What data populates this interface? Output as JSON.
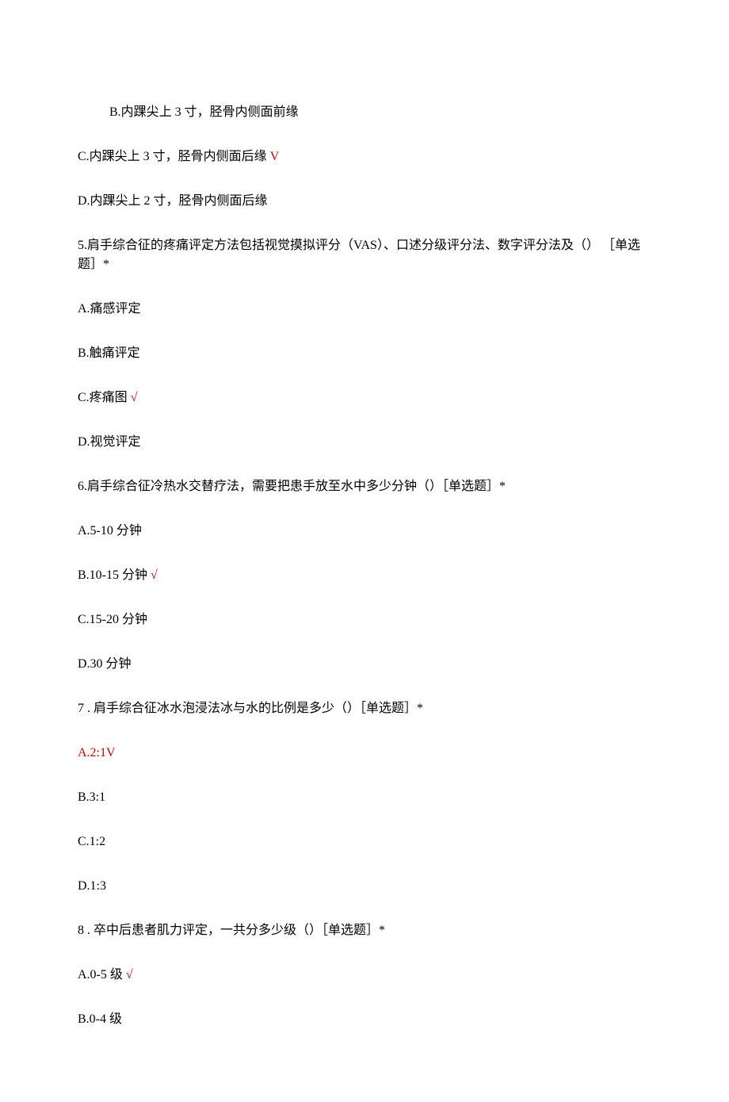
{
  "q4": {
    "b": "B.内踝尖上 3 寸，胫骨内侧面前缘",
    "c_text": "C.内踝尖上 3 寸，胫骨内侧面后缘",
    "c_mark": " V",
    "d": "D.内踝尖上 2 寸，胫骨内侧面后缘"
  },
  "q5": {
    "stem": "5.肩手综合征的疼痛评定方法包括视觉摸拟评分（VAS）、口述分级评分法、数字评分法及（） ［单选题］*",
    "a": "A.痛感评定",
    "b": "B.触痛评定",
    "c_text": "C.疼痛图",
    "c_mark": " √",
    "d": "D.视觉评定"
  },
  "q6": {
    "stem": "6.肩手综合征冷热水交替疗法，需要把患手放至水中多少分钟（）［单选题］*",
    "a": "A.5-10 分钟",
    "b_text": "B.10-15 分钟",
    "b_mark": " √",
    "c": "C.15-20 分钟",
    "d": "D.30 分钟"
  },
  "q7": {
    "stem": "7 . 肩手综合征冰水泡浸法冰与水的比例是多少（）［单选题］*",
    "a_text": "A.2:1",
    "a_mark": "V",
    "b": "B.3:1",
    "c": "C.1:2",
    "d": "D.1:3"
  },
  "q8": {
    "stem": "8 . 卒中后患者肌力评定，一共分多少级（）［单选题］*",
    "a_text": "A.0-5 级",
    "a_mark": " √",
    "b": "B.0-4 级"
  }
}
